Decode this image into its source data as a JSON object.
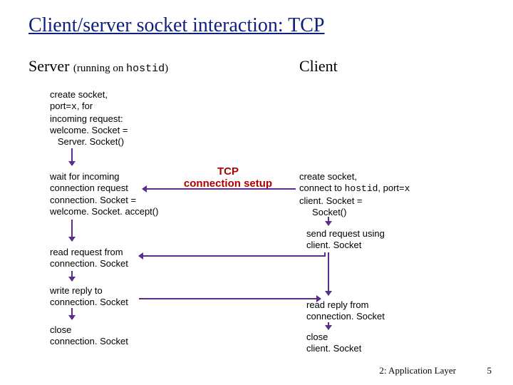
{
  "title": "Client/server socket interaction: TCP",
  "server": {
    "heading": "Server",
    "sub": "(running on ",
    "sub_mono": "hostid",
    "sub_end": ")",
    "b1_l1": "create socket,",
    "b1_l2a": "port=",
    "b1_l2b": "x",
    "b1_l2c": ", for",
    "b1_l3": "incoming request:",
    "b1_l4": "welcome. Socket =",
    "b1_l5": "   Server. Socket()",
    "b2_l1": "wait for incoming",
    "b2_l2": "connection request",
    "b2_l3": "connection. Socket =",
    "b2_l4": "welcome. Socket. accept()",
    "b3_l1": "read request from",
    "b3_l2": "connection. Socket",
    "b4_l1": "write reply to",
    "b4_l2": "connection. Socket",
    "b5_l1": "close",
    "b5_l2": "connection. Socket"
  },
  "client": {
    "heading": "Client",
    "c1_l1": "create socket,",
    "c1_l2a": "connect to ",
    "c1_l2b": "hostid",
    "c1_l2c": ", port=",
    "c1_l2d": "x",
    "c1_l3": "client. Socket =",
    "c1_l4": "     Socket()",
    "c2_l1": "send request using",
    "c2_l2": "client. Socket",
    "c3_l1": "read reply from",
    "c3_l2": "connection. Socket",
    "c4_l1": "close",
    "c4_l2": "client. Socket"
  },
  "tcp": {
    "l1": "TCP",
    "l2": "connection setup"
  },
  "footer": {
    "text": "2: Application Layer",
    "page": "5"
  }
}
